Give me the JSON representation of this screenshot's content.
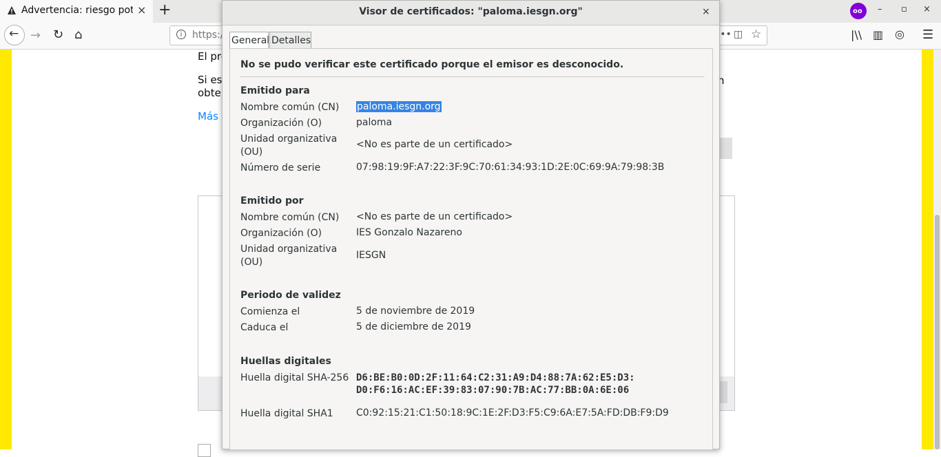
{
  "browser": {
    "tab_title": "Advertencia: riesgo poten",
    "tab_close": "×",
    "new_tab": "+",
    "url_prefix": "https:/",
    "window_controls": [
      "–",
      "▫",
      "×"
    ],
    "icons": [
      "back-icon",
      "forward-icon",
      "reload-icon",
      "home-icon",
      "library-icon",
      "sidebar-icon",
      "extension-icon",
      "menu-icon",
      "private-mask-icon",
      "page-actions-icon",
      "pocket-icon",
      "star-icon"
    ]
  },
  "page": {
    "line1": "El pro",
    "line2a": "Si est",
    "line2b": "obten",
    "link": "Más i",
    "right_fragment": "n"
  },
  "dialog": {
    "title": "Visor de certificados: \"paloma.iesgn.org\"",
    "close": "×",
    "tabs": {
      "general": "General",
      "details": "Detalles"
    },
    "warning": "No se pudo verificar este certificado porque el emisor es desconocido.",
    "issued_to": {
      "heading": "Emitido para",
      "cn_label": "Nombre común (CN)",
      "cn_value": "paloma.iesgn.org",
      "o_label": "Organización (O)",
      "o_value": "paloma",
      "ou_label_1": "Unidad organizativa",
      "ou_label_2": "(OU)",
      "ou_value": "<No es parte de un certificado>",
      "serial_label": "Número de serie",
      "serial_value": "07:98:19:9F:A7:22:3F:9C:70:61:34:93:1D:2E:0C:69:9A:79:98:3B"
    },
    "issued_by": {
      "heading": "Emitido por",
      "cn_label": "Nombre común (CN)",
      "cn_value": "<No es parte de un certificado>",
      "o_label": "Organización (O)",
      "o_value": "IES Gonzalo Nazareno",
      "ou_label_1": "Unidad organizativa",
      "ou_label_2": "(OU)",
      "ou_value": "IESGN"
    },
    "validity": {
      "heading": "Periodo de validez",
      "start_label": "Comienza el",
      "start_value": "5 de noviembre de 2019",
      "end_label": "Caduca el",
      "end_value": "5 de diciembre de 2019"
    },
    "fingerprints": {
      "heading": "Huellas digitales",
      "sha256_label": "Huella digital SHA-256",
      "sha256_line1": "D6:BE:B0:0D:2F:11:64:C2:31:A9:D4:88:7A:62:E5:D3:",
      "sha256_line2": "D0:F6:16:AC:EF:39:83:07:90:7B:AC:77:BB:0A:6E:06",
      "sha1_label": "Huella digital SHA1",
      "sha1_value": "C0:92:15:21:C1:50:18:9C:1E:2F:D3:F5:C9:6A:E7:5A:FD:DB:F9:D9"
    }
  }
}
